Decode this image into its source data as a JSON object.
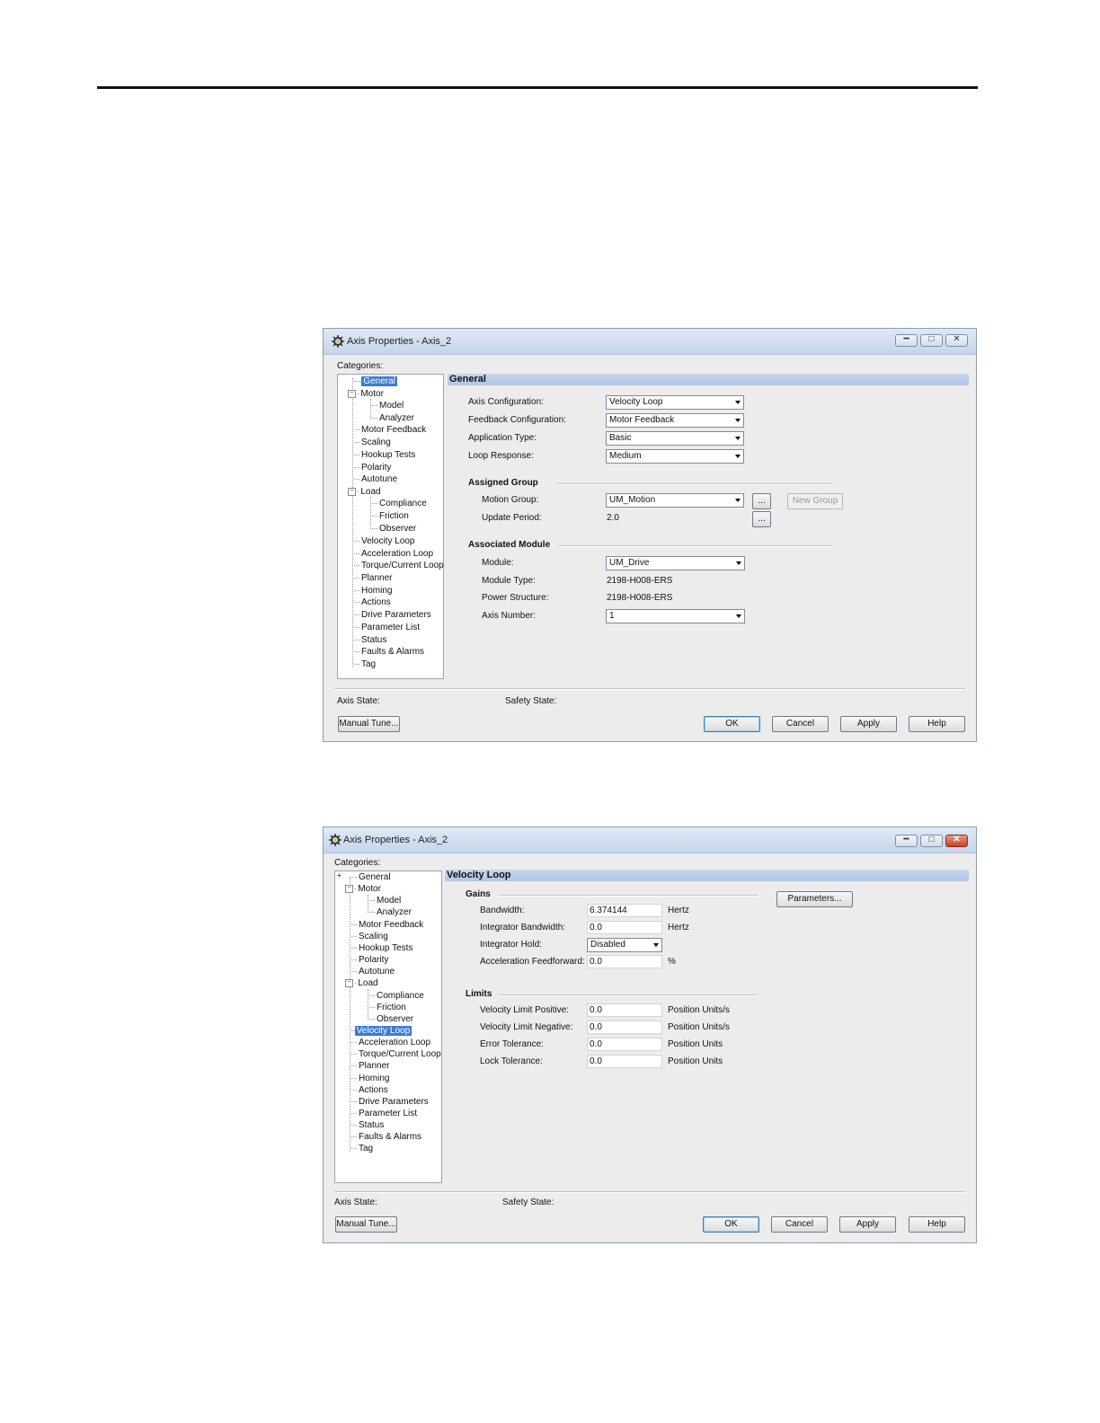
{
  "dialog1": {
    "title": "Axis Properties - Axis_2",
    "categories_label": "Categories:",
    "tree": {
      "general": "General",
      "motor": "Motor",
      "model": "Model",
      "analyzer": "Analyzer",
      "motor_feedback": "Motor Feedback",
      "scaling": "Scaling",
      "hookup_tests": "Hookup Tests",
      "polarity": "Polarity",
      "autotune": "Autotune",
      "load": "Load",
      "compliance": "Compliance",
      "friction": "Friction",
      "observer": "Observer",
      "velocity_loop": "Velocity Loop",
      "acceleration_loop": "Acceleration Loop",
      "torque_current_loop": "Torque/Current Loop",
      "planner": "Planner",
      "homing": "Homing",
      "actions": "Actions",
      "drive_parameters": "Drive Parameters",
      "parameter_list": "Parameter List",
      "status": "Status",
      "faults_alarms": "Faults & Alarms",
      "tag": "Tag"
    },
    "section_title": "General",
    "axis_configuration_label": "Axis Configuration:",
    "axis_configuration_value": "Velocity Loop",
    "feedback_configuration_label": "Feedback Configuration:",
    "feedback_configuration_value": "Motor Feedback",
    "application_type_label": "Application Type:",
    "application_type_value": "Basic",
    "loop_response_label": "Loop Response:",
    "loop_response_value": "Medium",
    "assigned_group_title": "Assigned Group",
    "motion_group_label": "Motion Group:",
    "motion_group_value": "UM_Motion",
    "browse_label": "...",
    "new_group_label": "New Group",
    "update_period_label": "Update Period:",
    "update_period_value": "2.0",
    "associated_module_title": "Associated Module",
    "module_label": "Module:",
    "module_value": "UM_Drive",
    "module_type_label": "Module Type:",
    "module_type_value": "2198-H008-ERS",
    "power_structure_label": "Power Structure:",
    "power_structure_value": "2198-H008-ERS",
    "axis_number_label": "Axis Number:",
    "axis_number_value": "1",
    "axis_state_label": "Axis State:",
    "safety_state_label": "Safety State:",
    "manual_tune_label": "Manual Tune...",
    "ok_label": "OK",
    "cancel_label": "Cancel",
    "apply_label": "Apply",
    "help_label": "Help"
  },
  "dialog2": {
    "title": "Axis Properties - Axis_2",
    "categories_label": "Categories:",
    "tree": {
      "general": "General",
      "motor": "Motor",
      "model": "Model",
      "analyzer": "Analyzer",
      "motor_feedback": "Motor Feedback",
      "scaling": "Scaling",
      "hookup_tests": "Hookup Tests",
      "polarity": "Polarity",
      "autotune": "Autotune",
      "load": "Load",
      "compliance": "Compliance",
      "friction": "Friction",
      "observer": "Observer",
      "velocity_loop": "Velocity Loop",
      "acceleration_loop": "Acceleration Loop",
      "torque_current_loop": "Torque/Current Loop",
      "planner": "Planner",
      "homing": "Homing",
      "actions": "Actions",
      "drive_parameters": "Drive Parameters",
      "parameter_list": "Parameter List",
      "status": "Status",
      "faults_alarms": "Faults & Alarms",
      "tag": "Tag"
    },
    "section_title": "Velocity Loop",
    "gains_title": "Gains",
    "parameters_label": "Parameters...",
    "bandwidth_label": "Bandwidth:",
    "bandwidth_value": "6.374144",
    "bandwidth_unit": "Hertz",
    "integrator_bandwidth_label": "Integrator Bandwidth:",
    "integrator_bandwidth_value": "0.0",
    "integrator_bandwidth_unit": "Hertz",
    "integrator_hold_label": "Integrator Hold:",
    "integrator_hold_value": "Disabled",
    "accel_feedforward_label": "Acceleration Feedforward:",
    "accel_feedforward_value": "0.0",
    "accel_feedforward_unit": "%",
    "limits_title": "Limits",
    "vel_limit_pos_label": "Velocity Limit Positive:",
    "vel_limit_pos_value": "0.0",
    "vel_limit_pos_unit": "Position Units/s",
    "vel_limit_neg_label": "Velocity Limit Negative:",
    "vel_limit_neg_value": "0.0",
    "vel_limit_neg_unit": "Position Units/s",
    "error_tolerance_label": "Error Tolerance:",
    "error_tolerance_value": "0.0",
    "error_tolerance_unit": "Position Units",
    "lock_tolerance_label": "Lock Tolerance:",
    "lock_tolerance_value": "0.0",
    "lock_tolerance_unit": "Position Units",
    "axis_state_label": "Axis State:",
    "safety_state_label": "Safety State:",
    "manual_tune_label": "Manual Tune...",
    "ok_label": "OK",
    "cancel_label": "Cancel",
    "apply_label": "Apply",
    "help_label": "Help"
  }
}
